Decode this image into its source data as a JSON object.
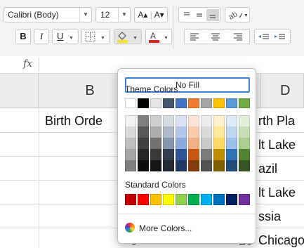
{
  "ribbon": {
    "font_name": "Calibri (Body)",
    "font_size": "12",
    "grow_font": "A▴",
    "shrink_font": "A▾",
    "bold": "B",
    "italic": "I",
    "underline": "U",
    "font_color_letter": "A",
    "fill_color": "#ffe600",
    "font_color": "#d9251c"
  },
  "formula_bar": {
    "fx": "fx"
  },
  "grid": {
    "columns": [
      "B",
      "D"
    ],
    "cells": {
      "b_row1": "Birth Orde",
      "d_row1": "rth Pla",
      "d_row2": "lt Lake",
      "d_row3": "azil",
      "d_row4": "lt Lake",
      "d_row5": "ssia",
      "b_row6": "5",
      "c_row6": "28",
      "d_row6": "Chicago"
    }
  },
  "fill_popup": {
    "no_fill": "No Fill",
    "theme_title": "Theme Colors",
    "standard_title": "Standard Colors",
    "more_colors": "More Colors...",
    "theme_colors": [
      "#ffffff",
      "#000000",
      "#e7e6e6",
      "#44546a",
      "#4472c4",
      "#ed7d31",
      "#a5a5a5",
      "#ffc000",
      "#5b9bd5",
      "#70ad47"
    ],
    "theme_shades": [
      [
        "#f2f2f2",
        "#d9d9d9",
        "#bfbfbf",
        "#a6a6a6",
        "#808080"
      ],
      [
        "#808080",
        "#595959",
        "#404040",
        "#262626",
        "#0d0d0d"
      ],
      [
        "#d0cece",
        "#aeabab",
        "#757171",
        "#3a3838",
        "#161616"
      ],
      [
        "#d6dce4",
        "#adb9ca",
        "#8497b0",
        "#333f4f",
        "#222b35"
      ],
      [
        "#d9e1f2",
        "#b4c6e7",
        "#8ea9db",
        "#2f5496",
        "#203864"
      ],
      [
        "#fce4d6",
        "#f8cbad",
        "#f4b084",
        "#c65911",
        "#833c0b"
      ],
      [
        "#ededed",
        "#dbdbdb",
        "#c9c9c9",
        "#7b7b7b",
        "#525252"
      ],
      [
        "#fff2cc",
        "#ffe699",
        "#ffd966",
        "#bf8f00",
        "#7f6000"
      ],
      [
        "#ddebf7",
        "#bdd7ee",
        "#9bc2e6",
        "#2f75b5",
        "#1f4e78"
      ],
      [
        "#e2efda",
        "#c6e0b4",
        "#a9d08e",
        "#548235",
        "#375623"
      ]
    ],
    "standard_colors": [
      "#c00000",
      "#ff0000",
      "#ffc000",
      "#ffff00",
      "#92d050",
      "#00b050",
      "#00b0f0",
      "#0070c0",
      "#002060",
      "#7030a0"
    ]
  }
}
